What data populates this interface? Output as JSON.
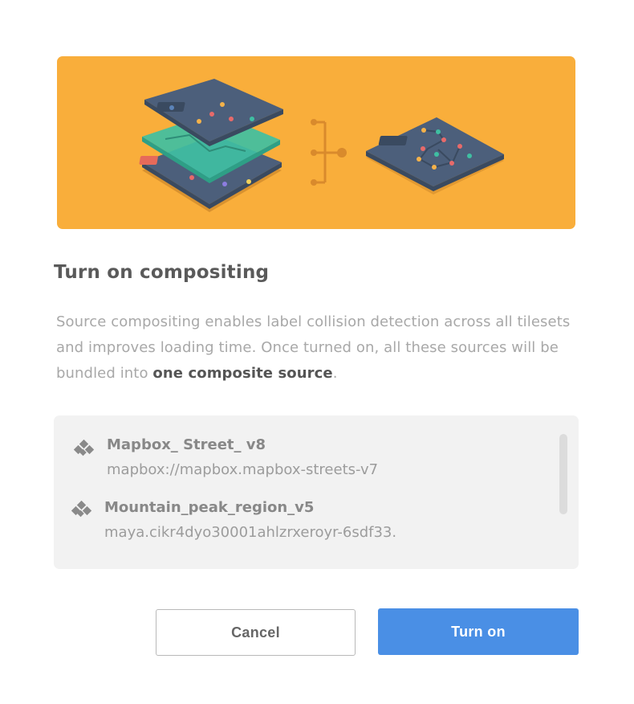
{
  "dialog": {
    "title": "Turn on compositing",
    "description_before": "Source compositing enables label collision detection across all tilesets and improves loading time. Once turned on, all these sources will be bundled into ",
    "description_bold": "one composite source",
    "description_after": "."
  },
  "hero": {
    "background_color": "#f9ae3b",
    "illustration": "stacked-tilesets-merge-illustration"
  },
  "sources": [
    {
      "name": "Mapbox_ Street_ v8",
      "id": "mapbox://mapbox.mapbox-streets-v7",
      "icon": "tileset-icon"
    },
    {
      "name": "Mountain_peak_region_v5",
      "id": "maya.cikr4dyo30001ahlzrxeroyr-6sdf33.",
      "icon": "tileset-icon"
    }
  ],
  "buttons": {
    "cancel_label": "Cancel",
    "confirm_label": "Turn on"
  },
  "colors": {
    "accent": "#4a8fe5",
    "hero": "#f9ae3b"
  }
}
